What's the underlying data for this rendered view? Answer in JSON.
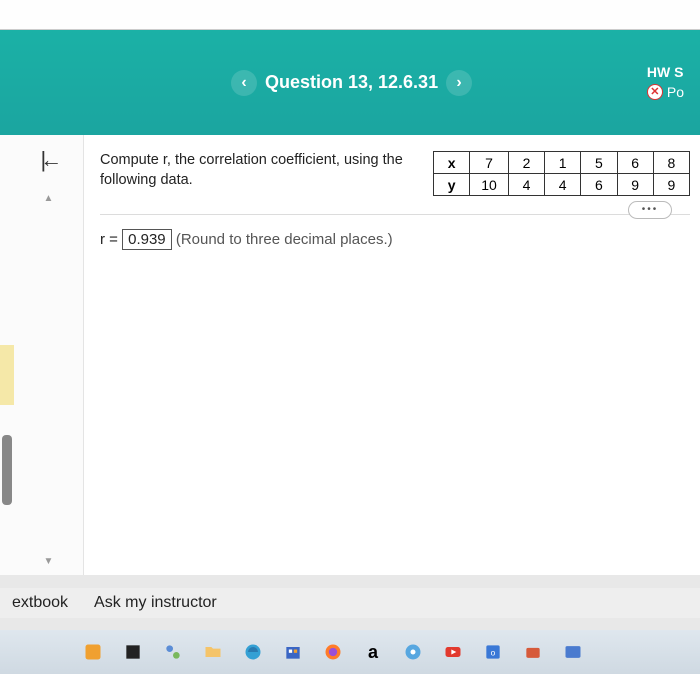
{
  "topstrip": "",
  "header": {
    "question_label": "Question 13, 12.6.31",
    "hw_line1": "HW S",
    "hw_line2": "Po"
  },
  "prompt": "Compute r, the correlation coefficient, using the following data.",
  "table": {
    "row_x_label": "x",
    "row_y_label": "y",
    "x": [
      "7",
      "2",
      "1",
      "5",
      "6",
      "8"
    ],
    "y": [
      "10",
      "4",
      "4",
      "6",
      "9",
      "9"
    ]
  },
  "more_label": "•••",
  "answer": {
    "prefix": "r =",
    "value": "0.939",
    "hint": "(Round to three decimal places.)"
  },
  "footer": {
    "textbook": "extbook",
    "ask": "Ask my instructor"
  },
  "taskbar": {
    "a_label": "a"
  },
  "chart_data": {
    "type": "table",
    "title": "Correlation data",
    "series": [
      {
        "name": "x",
        "values": [
          7,
          2,
          1,
          5,
          6,
          8
        ]
      },
      {
        "name": "y",
        "values": [
          10,
          4,
          4,
          6,
          9,
          9
        ]
      }
    ]
  }
}
